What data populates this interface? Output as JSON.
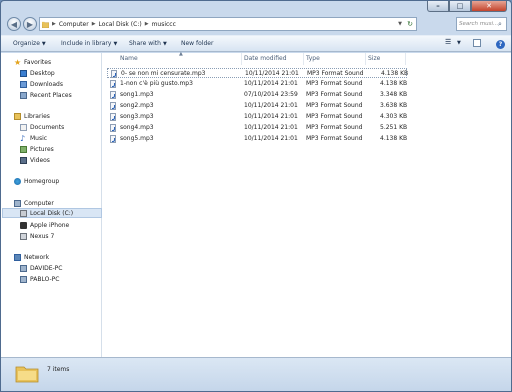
{
  "window": {
    "minimize": "–",
    "maximize": "□",
    "close": "✕"
  },
  "address": {
    "crumbs": [
      "Computer",
      "Local Disk (C:)",
      "musiccc"
    ],
    "search_placeholder": "Search musi..."
  },
  "toolbar": {
    "organize": "Organize",
    "include_in_library": "Include in library",
    "share_with": "Share with",
    "new_folder": "New folder"
  },
  "nav": {
    "favorites": "Favorites",
    "desktop": "Desktop",
    "downloads": "Downloads",
    "recent_places": "Recent Places",
    "libraries": "Libraries",
    "documents": "Documents",
    "music": "Music",
    "pictures": "Pictures",
    "videos": "Videos",
    "homegroup": "Homegroup",
    "computer": "Computer",
    "local_disk": "Local Disk (C:)",
    "apple_iphone": "Apple iPhone",
    "nexus7": "Nexus 7",
    "network": "Network",
    "davide_pc": "DAVIDE-PC",
    "pablo_pc": "PABLO-PC"
  },
  "columns": {
    "name": "Name",
    "date": "Date modified",
    "type": "Type",
    "size": "Size"
  },
  "files": [
    {
      "name": "0- se non mi censurate.mp3",
      "date": "10/11/2014 21:01",
      "type": "MP3 Format Sound",
      "size": "4.138 KB"
    },
    {
      "name": "1-non c'è più gusto.mp3",
      "date": "10/11/2014 21:01",
      "type": "MP3 Format Sound",
      "size": "4.138 KB"
    },
    {
      "name": "song1.mp3",
      "date": "07/10/2014 23:59",
      "type": "MP3 Format Sound",
      "size": "3.348 KB"
    },
    {
      "name": "song2.mp3",
      "date": "10/11/2014 21:01",
      "type": "MP3 Format Sound",
      "size": "3.638 KB"
    },
    {
      "name": "song3.mp3",
      "date": "10/11/2014 21:01",
      "type": "MP3 Format Sound",
      "size": "4.303 KB"
    },
    {
      "name": "song4.mp3",
      "date": "10/11/2014 21:01",
      "type": "MP3 Format Sound",
      "size": "5.251 KB"
    },
    {
      "name": "song5.mp3",
      "date": "10/11/2014 21:01",
      "type": "MP3 Format Sound",
      "size": "4.138 KB"
    }
  ],
  "status": {
    "item_count": "7 items"
  },
  "colors": {
    "accent": "#2e67c0",
    "folder": "#e8c25a"
  }
}
